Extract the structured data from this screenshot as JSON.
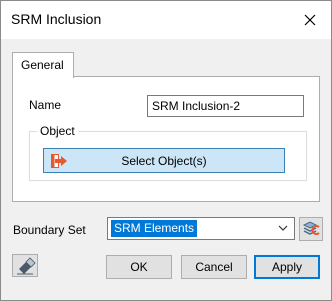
{
  "window": {
    "title": "SRM Inclusion",
    "close_icon": "close-icon"
  },
  "tabs": [
    {
      "label": "General",
      "active": true
    }
  ],
  "general": {
    "name_label": "Name",
    "name_value": "SRM Inclusion-2",
    "object_group_label": "Object",
    "select_objects_label": "Select Object(s)",
    "select_objects_icon": "select-arrow-icon"
  },
  "boundary_set": {
    "label": "Boundary Set",
    "selected": "SRM Elements",
    "dropdown_icon": "chevron-down-icon",
    "tool_icon": "boundary-set-layers-icon"
  },
  "footer": {
    "eraser_icon": "eraser-icon",
    "ok_label": "OK",
    "cancel_label": "Cancel",
    "apply_label": "Apply"
  },
  "colors": {
    "accent": "#0078d7",
    "select_button_bg": "#cde6f7",
    "select_icon_orange": "#e8582c"
  }
}
